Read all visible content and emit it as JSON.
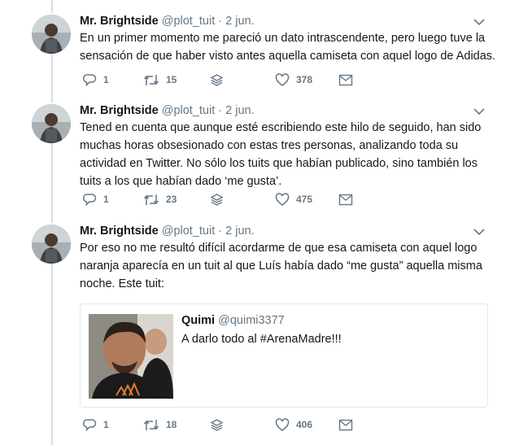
{
  "tweets": [
    {
      "name": "Mr. Brightside",
      "handle": "@plot_tuit",
      "sep": " · ",
      "date": "2 jun.",
      "text": "En un primer momento me pareció un dato intrascendente, pero luego tuve la\nsensación de que haber visto antes aquella camiseta con aquel logo de Adidas.",
      "replies": "1",
      "retweets": "15",
      "likes": "378"
    },
    {
      "name": "Mr. Brightside",
      "handle": "@plot_tuit",
      "sep": " · ",
      "date": "2 jun.",
      "text": "Tened en cuenta que aunque esté escribiendo este hilo de seguido, han sido\nmuchas horas obsesionado con estas tres personas, analizando toda su\nactividad en Twitter. No sólo los tuits que habían publicado, sino también los\ntuits a los que habían dado ‘me gusta’.",
      "replies": "1",
      "retweets": "23",
      "likes": "475"
    },
    {
      "name": "Mr. Brightside",
      "handle": "@plot_tuit",
      "sep": " · ",
      "date": "2 jun.",
      "text": "Por eso no me resultó difícil acordarme de que esa camiseta con aquel logo\nnaranja aparecía en un tuit al que Luís había dado “me gusta” aquella misma\nnoche. Este tuit:",
      "replies": "1",
      "retweets": "18",
      "likes": "406",
      "quote": {
        "name": "Quimi",
        "handle": "@quimi3377",
        "text": "A darlo todo al #ArenaMadre!!!"
      }
    }
  ],
  "colors": {
    "text": "#14171a",
    "muted": "#657786",
    "border": "#e1e8ed",
    "thread": "#d8dfe4"
  },
  "icons": [
    "reply-icon",
    "retweet-icon",
    "stack-icon",
    "heart-icon",
    "envelope-icon",
    "chevron-down-icon"
  ]
}
